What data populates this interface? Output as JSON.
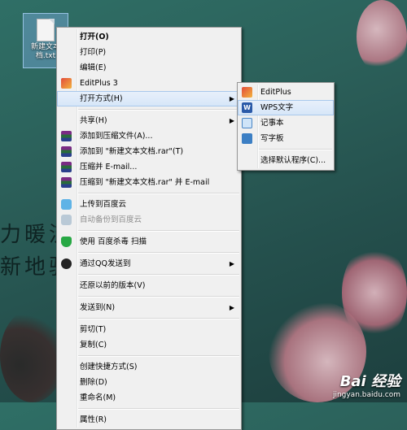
{
  "desktop": {
    "file_label_line1": "新建文本",
    "file_label_line2": "档.txt",
    "bg_text_line1": "力暖流",
    "bg_text_line2": "新地驱"
  },
  "context_menu": {
    "items": [
      {
        "label": "打开(O)"
      },
      {
        "label": "打印(P)"
      },
      {
        "label": "编辑(E)"
      },
      {
        "label": "EditPlus 3"
      },
      {
        "label": "打开方式(H)"
      },
      {
        "label": "共享(H)"
      },
      {
        "label": "添加到压缩文件(A)..."
      },
      {
        "label": "添加到 \"新建文本文档.rar\"(T)"
      },
      {
        "label": "压缩并 E-mail..."
      },
      {
        "label": "压缩到 \"新建文本文档.rar\" 并 E-mail"
      },
      {
        "label": "上传到百度云"
      },
      {
        "label": "自动备份到百度云"
      },
      {
        "label": "使用 百度杀毒 扫描"
      },
      {
        "label": "通过QQ发送到"
      },
      {
        "label": "还原以前的版本(V)"
      },
      {
        "label": "发送到(N)"
      },
      {
        "label": "剪切(T)"
      },
      {
        "label": "复制(C)"
      },
      {
        "label": "创建快捷方式(S)"
      },
      {
        "label": "删除(D)"
      },
      {
        "label": "重命名(M)"
      },
      {
        "label": "属性(R)"
      }
    ]
  },
  "open_with_menu": {
    "items": [
      {
        "label": "EditPlus"
      },
      {
        "label": "WPS文字"
      },
      {
        "label": "记事本"
      },
      {
        "label": "写字板"
      },
      {
        "label": "选择默认程序(C)..."
      }
    ],
    "wps_glyph": "W"
  },
  "watermark": {
    "brand": "Bai 经验",
    "url": "jingyan.baidu.com"
  },
  "colors": {
    "menu_bg": "#f0f0f0",
    "highlight": "#d6e6f8",
    "desktop_bg": "#2b5f59"
  }
}
